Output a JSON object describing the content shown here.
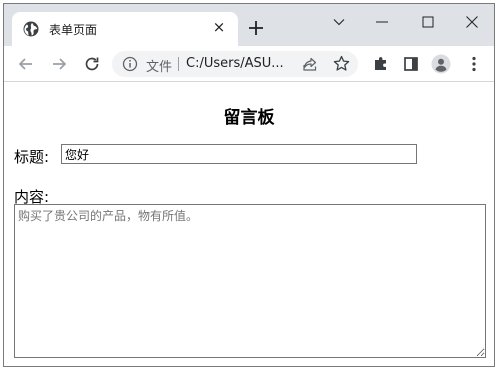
{
  "browser": {
    "tab": {
      "favicon": "globe-icon",
      "title": "表单页面",
      "close_symbol": "×"
    },
    "new_tab_icon": "plus-icon",
    "window_controls": [
      "chevron-down-icon",
      "minimize-icon",
      "maximize-icon",
      "close-icon"
    ],
    "toolbar": {
      "icons": [
        "back-arrow-icon",
        "forward-arrow-icon",
        "reload-icon",
        "puzzle-icon",
        "side-panel-icon",
        "profile-icon",
        "kebab-menu-icon"
      ]
    },
    "omnibox": {
      "info_icon": "info-icon",
      "scheme_label": "文件",
      "url": "C:/Users/ASU...",
      "icons": [
        "share-icon",
        "star-icon"
      ]
    }
  },
  "form": {
    "heading": "留言板",
    "title_label": "标题:",
    "title_value": "您好",
    "content_label": "内容:",
    "content_placeholder": "购买了贵公司的产品，物有所值。"
  },
  "colors": {
    "titlebar_bg": "#dee1e6",
    "omnibox_bg": "#f1f3f4",
    "icon_color": "#5f6368"
  }
}
